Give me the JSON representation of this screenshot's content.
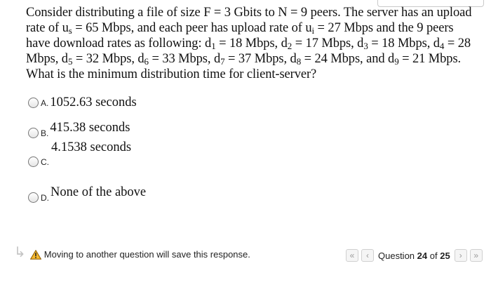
{
  "question": {
    "p1": "Consider distributing a file of size F = 3 Gbits   to N = 9 peers. The server has an upload rate of u",
    "s_sub": "s",
    "p2": " = 65 Mbps, and each peer has upload rate of u",
    "i_sub": "i",
    "p3": " = 27 Mbps and the 9 peers have download rates as following: d",
    "d1_sub": "1",
    "p4": " = 18 Mbps, d",
    "d2_sub": "2",
    "p5": " = 17 Mbps, d",
    "d3_sub": "3",
    "p6": " = 18 Mbps, d",
    "d4_sub": "4",
    "p7": " = 28 Mbps, d",
    "d5_sub": "5",
    "p8": " = 32 Mbps, d",
    "d6_sub": "6",
    "p9": " = 33 Mbps, d",
    "d7_sub": "7",
    "p10": " = 37 Mbps, d",
    "d8_sub": "8",
    "p11": " = 24 Mbps, and d",
    "d9_sub": "9",
    "p12": " = 21 Mbps. What is the minimum distribution time for client-server?"
  },
  "options": [
    {
      "letter": "A.",
      "text": "1052.63 seconds"
    },
    {
      "letter": "B.",
      "text": "415.38 seconds"
    },
    {
      "letter": "C.",
      "text": "4.1538 seconds"
    },
    {
      "letter": "D.",
      "text": "None of the above"
    }
  ],
  "footer": {
    "note": "Moving to another question will save this response.",
    "question_word": "Question",
    "current": "24",
    "of_word": "of",
    "total": "25",
    "first_icon": "«",
    "prev_icon": "‹",
    "next_icon": "›",
    "last_icon": "»"
  },
  "icons": {
    "turn": "turn-arrow-icon",
    "warning": "warning-icon"
  },
  "colors": {
    "warning_fill": "#f5b82e",
    "nav_border": "#d0d0d0"
  }
}
